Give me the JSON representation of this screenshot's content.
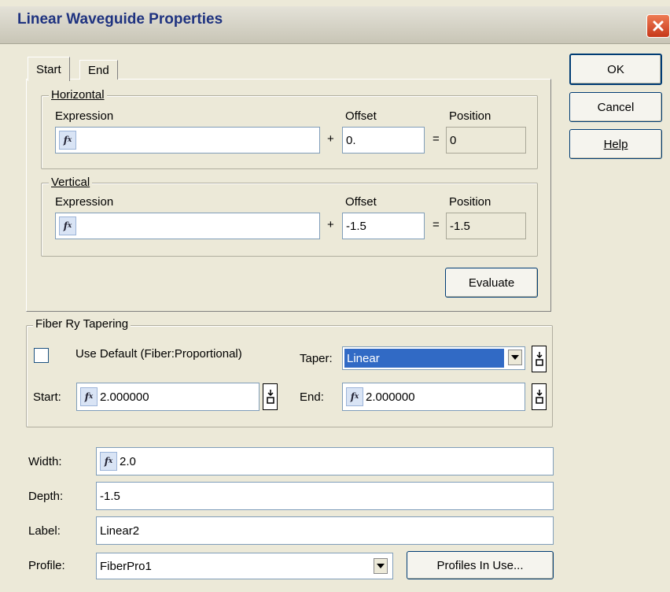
{
  "window": {
    "title": "Linear Waveguide Properties"
  },
  "tabs": [
    {
      "label": "Start"
    },
    {
      "label": "End"
    }
  ],
  "horizontal": {
    "group_label": "Horizontal",
    "expression_label": "Expression",
    "expression_value": "",
    "plus": "+",
    "offset_label": "Offset",
    "offset_value": "0.",
    "equals": "=",
    "position_label": "Position",
    "position_value": "0"
  },
  "vertical": {
    "group_label": "Vertical",
    "expression_label": "Expression",
    "expression_value": "",
    "plus": "+",
    "offset_label": "Offset",
    "offset_value": "-1.5",
    "equals": "=",
    "position_label": "Position",
    "position_value": "-1.5"
  },
  "evaluate_button": {
    "label": "Evaluate"
  },
  "tapering": {
    "group_label": "Fiber Ry Tapering",
    "use_default_label": "Use Default (Fiber:Proportional)",
    "use_default_checked": false,
    "taper_label": "Taper:",
    "taper_value": "Linear",
    "start_label": "Start:",
    "start_value": "2.000000",
    "end_label": "End:",
    "end_value": "2.000000"
  },
  "props": {
    "width_label": "Width:",
    "width_value": "2.0",
    "depth_label": "Depth:",
    "depth_value": "-1.5",
    "label_label": "Label:",
    "label_value": "Linear2",
    "profile_label": "Profile:",
    "profile_value": "FiberPro1",
    "profiles_in_use_label": "Profiles In Use..."
  },
  "buttons": {
    "ok": "OK",
    "cancel": "Cancel",
    "help": "Help"
  },
  "icons": {
    "fx": "function-icon",
    "spin": "spinner-icon",
    "dropdown": "dropdown-arrow-icon",
    "close": "close-icon"
  },
  "colors": {
    "title_text": "#1f3380",
    "selection": "#316ac5",
    "close_button": "#d9461f"
  }
}
